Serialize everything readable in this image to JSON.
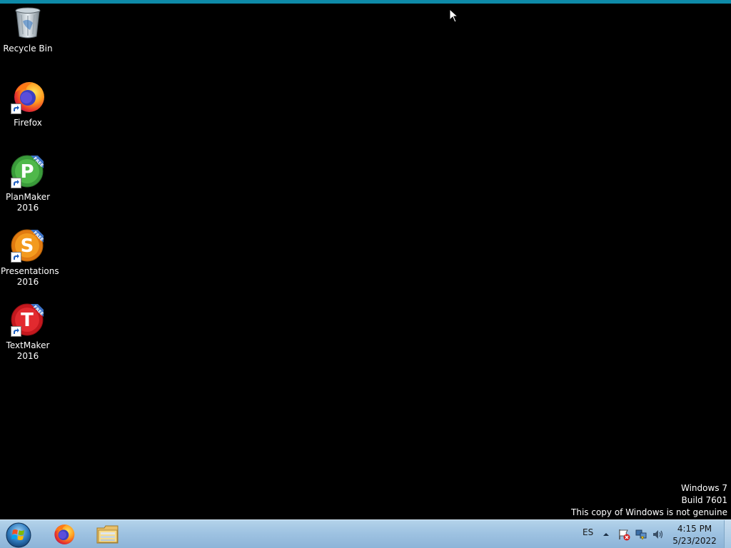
{
  "desktop": {
    "background_color": "#000000",
    "accent_strip_color": "#0e8aa8",
    "icons": [
      {
        "label": "Recycle Bin",
        "icon": "recycle-bin-icon"
      },
      {
        "label": "Firefox",
        "icon": "firefox-icon"
      },
      {
        "label": "PlanMaker\n2016",
        "icon": "planmaker-icon",
        "badge": "FREE"
      },
      {
        "label": "Presentations\n2016",
        "icon": "presentations-icon",
        "badge": "FREE"
      },
      {
        "label": "TextMaker\n2016",
        "icon": "textmaker-icon",
        "badge": "FREE"
      }
    ],
    "watermark": {
      "line1": "Windows 7",
      "line2": "Build 7601",
      "line3": "This copy of Windows is not genuine"
    }
  },
  "taskbar": {
    "start_icon": "windows-start-icon",
    "pinned_apps": [
      {
        "name": "Firefox",
        "icon": "firefox-icon"
      },
      {
        "name": "Windows Explorer",
        "icon": "folder-icon"
      }
    ],
    "tray": {
      "language": "ES",
      "icons": [
        "show-hidden-icons-arrow",
        "action-center-flag-icon",
        "network-icon",
        "volume-icon"
      ]
    },
    "clock": {
      "time": "4:15 PM",
      "date": "5/23/2022"
    }
  }
}
